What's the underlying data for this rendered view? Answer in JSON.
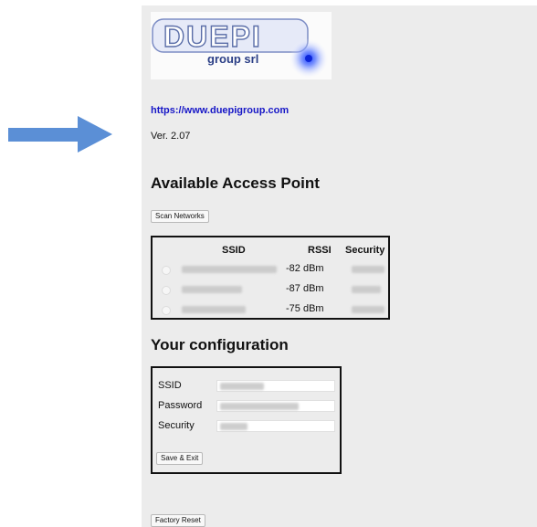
{
  "colors": {
    "panel_bg": "#ececec",
    "link": "#1717c7",
    "arrow": "#5b8fd6"
  },
  "logo": {
    "brand": "DUEPI",
    "sub": "group srl"
  },
  "link": {
    "text": "https://www.duepigroup.com"
  },
  "version": {
    "text": "Ver. 2.07"
  },
  "access_point": {
    "title": "Available Access Point",
    "scan_label": "Scan Networks",
    "columns": {
      "ssid": "SSID",
      "rssi": "RSSI",
      "security": "Security"
    },
    "rows": [
      {
        "rssi": "-82 dBm"
      },
      {
        "rssi": "-87 dBm"
      },
      {
        "rssi": "-75 dBm"
      }
    ]
  },
  "config": {
    "title": "Your configuration",
    "ssid_label": "SSID",
    "password_label": "Password",
    "security_label": "Security",
    "save_label": "Save & Exit"
  },
  "factory_reset_label": "Factory Reset",
  "icons": {
    "arrow": "arrow-right-icon",
    "radio": "radio-icon"
  }
}
